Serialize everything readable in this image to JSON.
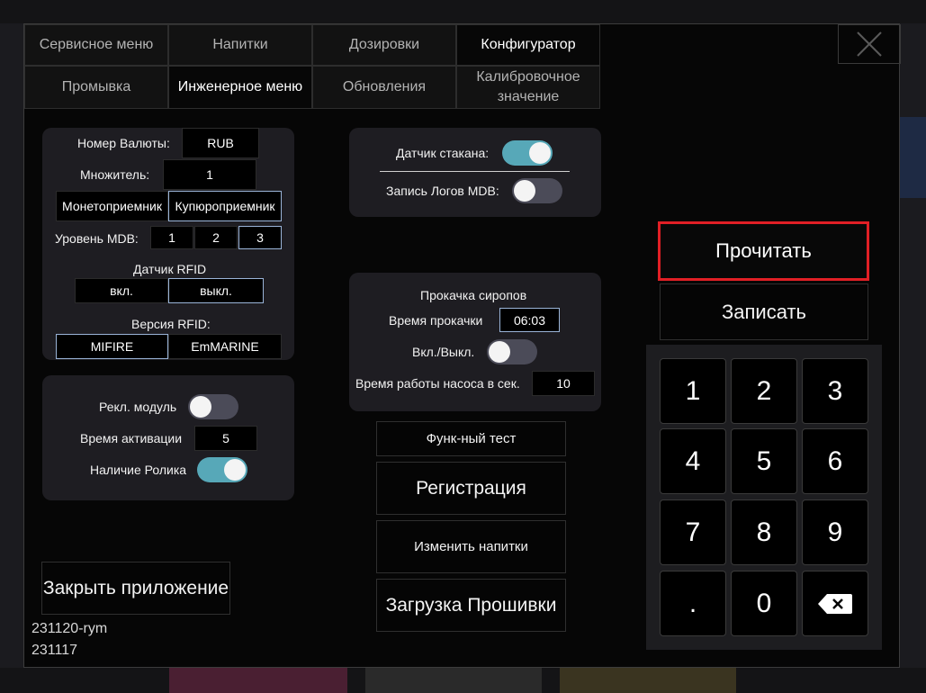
{
  "tabs_row1": [
    "Сервисное меню",
    "Напитки",
    "Дозировки",
    "Конфигуратор"
  ],
  "tabs_row2": [
    "Промывка",
    "Инженерное меню",
    "Обновления",
    "Калибровочное значение"
  ],
  "currency": {
    "label": "Номер Валюты:",
    "value": "RUB"
  },
  "multiplier": {
    "label": "Множитель:",
    "value": "1"
  },
  "acceptors": [
    "Монетоприемник",
    "Купюроприемник"
  ],
  "mdb": {
    "label": "Уровень MDB:",
    "options": [
      "1",
      "2",
      "3"
    ],
    "selected": "3"
  },
  "rfid_sensor": {
    "label": "Датчик RFID",
    "options": [
      "вкл.",
      "выкл."
    ],
    "selected": "выкл."
  },
  "rfid_version": {
    "label": "Версия RFID:",
    "options": [
      "MIFIRE",
      "EmMARINE"
    ],
    "selected": "MIFIRE"
  },
  "ad_panel": {
    "ad_module_label": "Рекл. модуль",
    "ad_module_on": false,
    "activation_label": "Время активации",
    "activation_value": "5",
    "roll_label": "Наличие Ролика",
    "roll_on": true
  },
  "sensor_panel": {
    "cup_sensor_label": "Датчик стакана:",
    "cup_sensor_on": true,
    "mdb_log_label": "Запись Логов MDB:",
    "mdb_log_on": false
  },
  "syrup_panel": {
    "title": "Прокачка сиропов",
    "time_label": "Время прокачки",
    "time_value": "06:03",
    "onoff_label": "Вкл./Выкл.",
    "onoff_on": false,
    "pump_label": "Время работы насоса в сек.",
    "pump_value": "10"
  },
  "buttons": {
    "func_test": "Функ-ный тест",
    "register": "Регистрация",
    "change_drinks": "Изменить напитки",
    "firmware": "Загрузка Прошивки",
    "close_app": "Закрыть приложение",
    "read": "Прочитать",
    "write": "Записать"
  },
  "keypad": [
    "1",
    "2",
    "3",
    "4",
    "5",
    "6",
    "7",
    "8",
    "9",
    ".",
    "0"
  ],
  "keypad_backspace_icon": "backspace-icon",
  "version": {
    "line1": "231120-rym",
    "line2": "231117"
  },
  "colors": {
    "toggle_on": "#57a8b8",
    "toggle_off": "#4b4b58",
    "highlight": "#e11f25",
    "selected_border": "#9ab4d8"
  }
}
